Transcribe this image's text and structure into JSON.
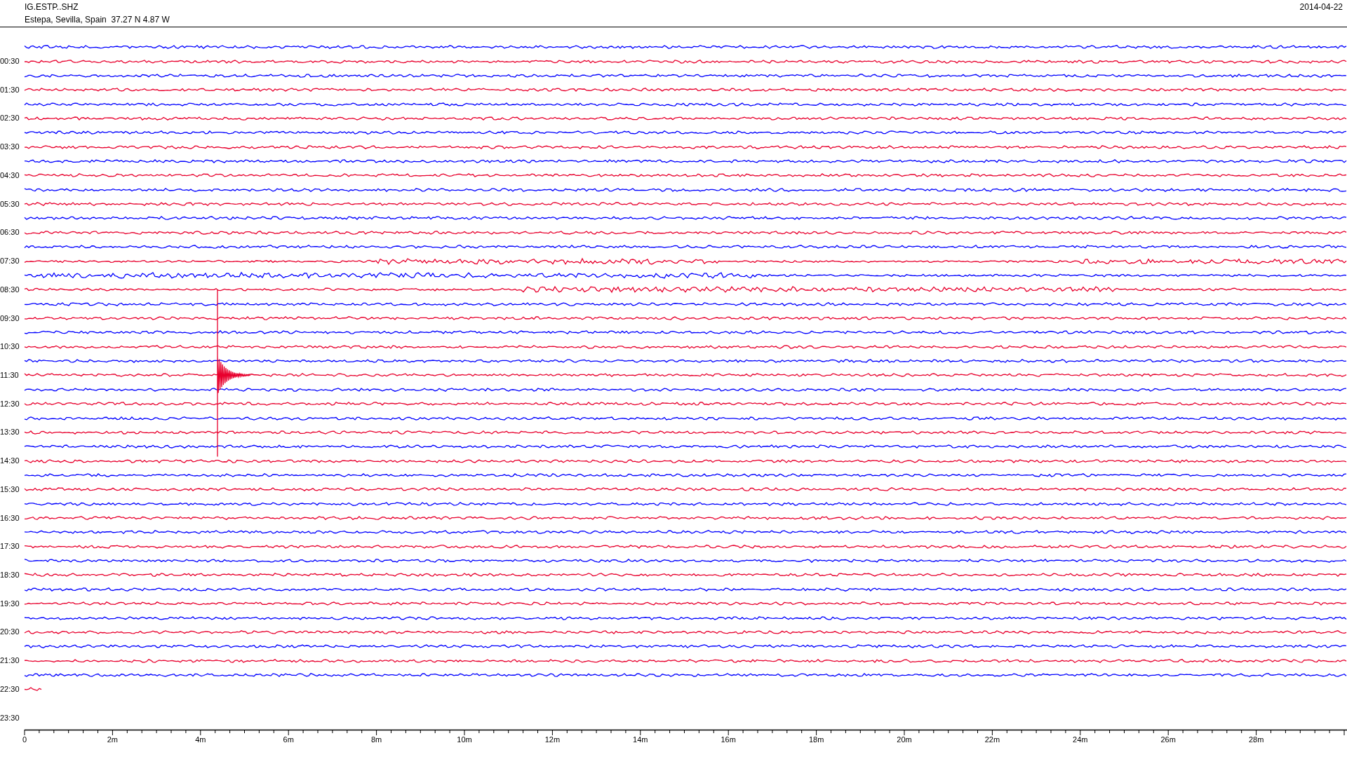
{
  "header": {
    "station": "IG.ESTP..SHZ",
    "location": "Estepa, Sevilla, Spain  37.27 N 4.87 W",
    "date": "2014-04-22"
  },
  "hour_labels": [
    "00:30",
    "01:30",
    "02:30",
    "03:30",
    "04:30",
    "05:30",
    "06:30",
    "07:30",
    "08:30",
    "09:30",
    "10:30",
    "11:30",
    "12:30",
    "13:30",
    "14:30",
    "15:30",
    "16:30",
    "17:30",
    "18:30",
    "19:30",
    "20:30",
    "21:30",
    "22:30",
    "23:30"
  ],
  "traces": [
    {
      "color": "#0000ff",
      "kind": "normal"
    },
    {
      "color": "#e8002d",
      "kind": "normal"
    },
    {
      "color": "#0000ff",
      "kind": "normal"
    },
    {
      "color": "#e8002d",
      "kind": "normal"
    },
    {
      "color": "#0000ff",
      "kind": "normal"
    },
    {
      "color": "#e8002d",
      "kind": "normal"
    },
    {
      "color": "#0000ff",
      "kind": "normal"
    },
    {
      "color": "#e8002d",
      "kind": "normal"
    },
    {
      "color": "#0000ff",
      "kind": "normal"
    },
    {
      "color": "#e8002d",
      "kind": "normal"
    },
    {
      "color": "#0000ff",
      "kind": "normal"
    },
    {
      "color": "#e8002d",
      "kind": "normal"
    },
    {
      "color": "#0000ff",
      "kind": "normal"
    },
    {
      "color": "#e8002d",
      "kind": "normal"
    },
    {
      "color": "#0000ff",
      "kind": "normal"
    },
    {
      "color": "#e8002d",
      "kind": "noisy"
    },
    {
      "color": "#0000ff",
      "kind": "noisy"
    },
    {
      "color": "#e8002d",
      "kind": "noisy"
    },
    {
      "color": "#0000ff",
      "kind": "normal"
    },
    {
      "color": "#e8002d",
      "kind": "normal"
    },
    {
      "color": "#0000ff",
      "kind": "normal"
    },
    {
      "color": "#e8002d",
      "kind": "normal"
    },
    {
      "color": "#0000ff",
      "kind": "normal"
    },
    {
      "color": "#e8002d",
      "kind": "normal"
    },
    {
      "color": "#0000ff",
      "kind": "normal"
    },
    {
      "color": "#e8002d",
      "kind": "normal"
    },
    {
      "color": "#0000ff",
      "kind": "normal"
    },
    {
      "color": "#e8002d",
      "kind": "normal"
    },
    {
      "color": "#0000ff",
      "kind": "normal"
    },
    {
      "color": "#e8002d",
      "kind": "normal"
    },
    {
      "color": "#0000ff",
      "kind": "normal"
    },
    {
      "color": "#e8002d",
      "kind": "normal"
    },
    {
      "color": "#0000ff",
      "kind": "normal"
    },
    {
      "color": "#e8002d",
      "kind": "normal"
    },
    {
      "color": "#0000ff",
      "kind": "normal"
    },
    {
      "color": "#e8002d",
      "kind": "normal"
    },
    {
      "color": "#0000ff",
      "kind": "normal"
    },
    {
      "color": "#e8002d",
      "kind": "normal"
    },
    {
      "color": "#0000ff",
      "kind": "normal"
    },
    {
      "color": "#e8002d",
      "kind": "normal"
    },
    {
      "color": "#0000ff",
      "kind": "normal"
    },
    {
      "color": "#e8002d",
      "kind": "normal"
    },
    {
      "color": "#0000ff",
      "kind": "normal"
    },
    {
      "color": "#e8002d",
      "kind": "normal"
    },
    {
      "color": "#0000ff",
      "kind": "normal"
    },
    {
      "color": "#e8002d",
      "kind": "partial"
    }
  ],
  "axis_labels": [
    "0",
    "2m",
    "4m",
    "6m",
    "8m",
    "10m",
    "12m",
    "14m",
    "16m",
    "18m",
    "20m",
    "22m",
    "24m",
    "26m",
    "28m"
  ]
}
